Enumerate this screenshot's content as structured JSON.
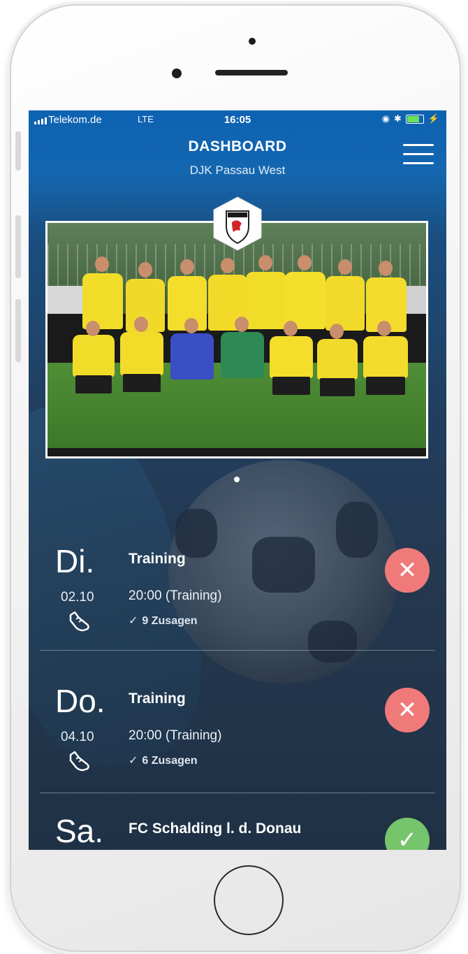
{
  "status_bar": {
    "carrier": "Telekom.de",
    "network": "LTE",
    "time": "16:05",
    "battery_level": 0.7
  },
  "header": {
    "title": "DASHBOARD",
    "subtitle": "DJK Passau West",
    "menu_icon": "hamburger-menu-icon"
  },
  "carousel": {
    "page_count": 1,
    "active_index": 0
  },
  "events": [
    {
      "day": "Di.",
      "date": "02.10",
      "icon": "football-boot-icon",
      "title": "Training",
      "time": "20:00 (Training)",
      "accepts_check": "✓",
      "accepts": "9 Zusagen",
      "action_state": "decline",
      "action_icon": "close-icon",
      "action_color": "#f07a7a"
    },
    {
      "day": "Do.",
      "date": "04.10",
      "icon": "football-boot-icon",
      "title": "Training",
      "time": "20:00 (Training)",
      "accepts_check": "✓",
      "accepts": "6 Zusagen",
      "action_state": "decline",
      "action_icon": "close-icon",
      "action_color": "#f07a7a"
    },
    {
      "day": "Sa.",
      "title": "FC Schalding l. d. Donau",
      "action_state": "accept",
      "action_icon": "check-icon",
      "action_color": "#76c46c"
    }
  ],
  "colors": {
    "header_blue": "#0d62b2",
    "decline": "#f07a7a",
    "accept": "#76c46c"
  }
}
